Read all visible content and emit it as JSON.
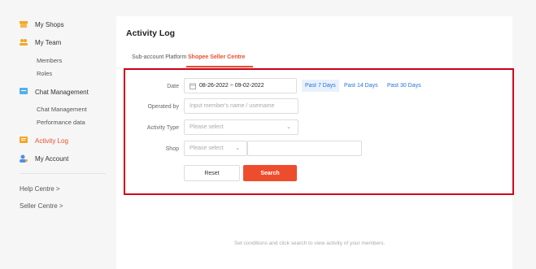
{
  "sidebar": {
    "my_shops": "My Shops",
    "my_team": "My Team",
    "members": "Members",
    "roles": "Roles",
    "chat_management": "Chat Management",
    "chat_management_sub": "Chat Management",
    "performance_data": "Performance data",
    "activity_log": "Activity Log",
    "my_account": "My Account",
    "help_centre": "Help Centre  >",
    "seller_centre": "Seller Centre  >"
  },
  "main": {
    "title": "Activity Log",
    "tabs": [
      "Sub-account Platform",
      "Shopee Seller Centre"
    ],
    "filters": {
      "date_label": "Date",
      "date_value": "08-26-2022 ~ 09-02-2022",
      "quick_ranges": [
        "Past 7 Days",
        "Past 14 Days",
        "Past 30 Days"
      ],
      "operated_by_label": "Operated by",
      "operated_by_placeholder": "Input member's name / username",
      "activity_type_label": "Activity Type",
      "activity_type_placeholder": "Please select",
      "shop_label": "Shop",
      "shop_placeholder": "Please select"
    },
    "reset_label": "Reset",
    "search_label": "Search",
    "empty_message": "Set conditions and click search to view activity of your members."
  },
  "colors": {
    "accent": "#ee4d2d",
    "link": "#2673dd",
    "highlight_border": "#d0011b"
  }
}
